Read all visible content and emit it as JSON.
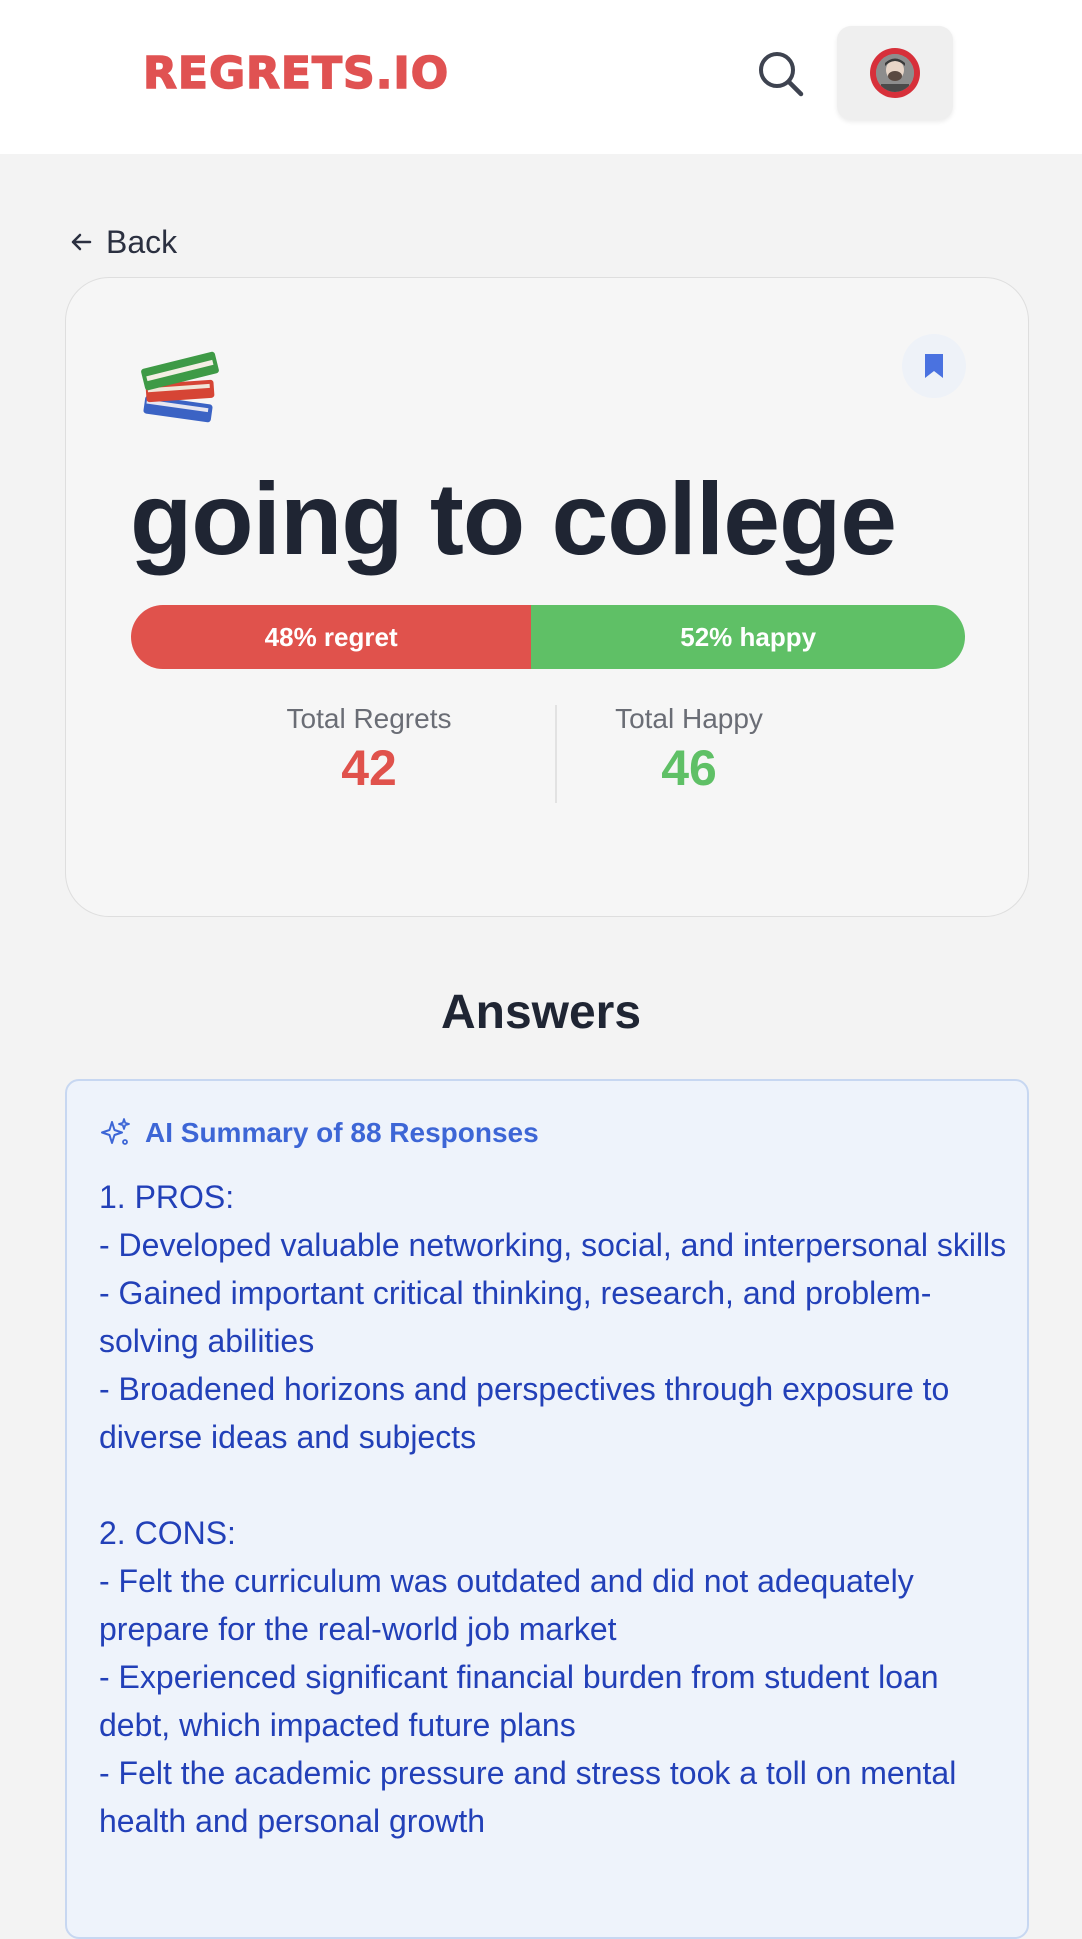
{
  "header": {
    "logo": "REGRETS.IO",
    "search_icon": "search-icon",
    "avatar_icon": "user-avatar"
  },
  "nav": {
    "back_label": "Back",
    "back_icon": "arrow-left-icon"
  },
  "question": {
    "emoji_icon": "books-icon",
    "bookmark_icon": "bookmark-icon",
    "title": "going to college",
    "regret_percent": 48,
    "happy_percent": 52,
    "regret_label": "48% regret",
    "happy_label": "52% happy",
    "total_regrets_label": "Total Regrets",
    "total_regrets": "42",
    "total_happy_label": "Total Happy",
    "total_happy": "46"
  },
  "answers": {
    "title": "Answers",
    "summary_title": "AI Summary of 88 Responses",
    "summary_icon": "sparkle-icon",
    "summary_lines": [
      "1. PROS:",
      "- Developed valuable networking, social, and interpersonal skills",
      "- Gained important critical thinking, research, and problem-solving abilities",
      "- Broadened horizons and perspectives through exposure to diverse ideas and subjects",
      "",
      "2. CONS:",
      "- Felt the curriculum was outdated and did not adequately prepare for the real-world job market",
      "- Experienced significant financial burden from student loan debt, which impacted future plans",
      "- Felt the academic pressure and stress took a toll on mental health and personal growth"
    ]
  },
  "colors": {
    "brand": "#e05252",
    "regret": "#e0524c",
    "happy": "#5fc066",
    "summary_text": "#2240b8",
    "accent_blue": "#3d66d6"
  }
}
